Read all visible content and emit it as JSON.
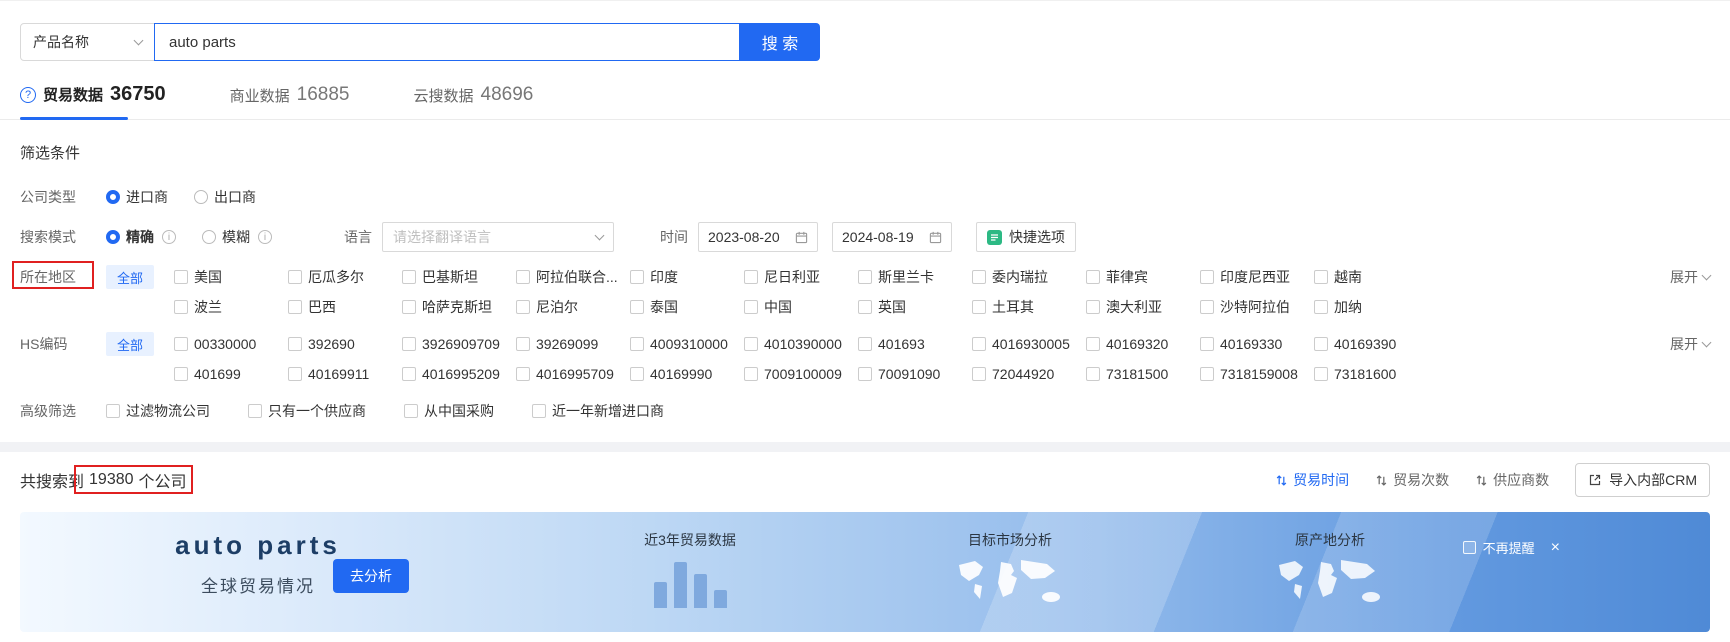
{
  "colors": {
    "accent": "#2169f2"
  },
  "search": {
    "category": "产品名称",
    "query": "auto parts",
    "button_label": "搜 索"
  },
  "tabs": [
    {
      "label": "贸易数据",
      "count": "36750"
    },
    {
      "label": "商业数据",
      "count": "16885"
    },
    {
      "label": "云搜数据",
      "count": "48696"
    }
  ],
  "filters": {
    "title": "筛选条件",
    "company_type": {
      "label": "公司类型",
      "importer": "进口商",
      "exporter": "出口商"
    },
    "search_mode": {
      "label": "搜索模式",
      "exact": "精确",
      "fuzzy": "模糊"
    },
    "language": {
      "label": "语言",
      "placeholder": "请选择翻译语言"
    },
    "time": {
      "label": "时间",
      "start": "2023-08-20",
      "end": "2024-08-19"
    },
    "quick_options": "快捷选项",
    "region": {
      "label": "所在地区",
      "all_label": "全部",
      "expand_label": "展开",
      "row1": [
        "美国",
        "厄瓜多尔",
        "巴基斯坦",
        "阿拉伯联合...",
        "印度",
        "尼日利亚",
        "斯里兰卡",
        "委内瑞拉",
        "菲律宾",
        "印度尼西亚",
        "越南"
      ],
      "row2": [
        "波兰",
        "巴西",
        "哈萨克斯坦",
        "尼泊尔",
        "泰国",
        "中国",
        "英国",
        "土耳其",
        "澳大利亚",
        "沙特阿拉伯",
        "加纳"
      ]
    },
    "hs_code": {
      "label": "HS编码",
      "all_label": "全部",
      "expand_label": "展开",
      "row1": [
        "00330000",
        "392690",
        "3926909709",
        "39269099",
        "4009310000",
        "4010390000",
        "401693",
        "4016930005",
        "40169320",
        "40169330",
        "40169390"
      ],
      "row2": [
        "401699",
        "40169911",
        "4016995209",
        "4016995709",
        "40169990",
        "7009100009",
        "70091090",
        "72044920",
        "73181500",
        "7318159008",
        "73181600"
      ]
    },
    "advanced": {
      "label": "高级筛选",
      "options": [
        "过滤物流公司",
        "只有一个供应商",
        "从中国采购",
        "近一年新增进口商"
      ]
    }
  },
  "results": {
    "prefix": "共搜索到",
    "count": "19380",
    "suffix": "个公司",
    "sorts": [
      "贸易时间",
      "贸易次数",
      "供应商数"
    ],
    "crm_button": "导入内部CRM"
  },
  "banner": {
    "title": "auto parts",
    "subtitle": "全球贸易情况",
    "analyze_button": "去分析",
    "col1_title": "近3年贸易数据",
    "col2_title": "目标市场分析",
    "col3_title": "原产地分析",
    "dismiss_label": "不再提醒"
  }
}
